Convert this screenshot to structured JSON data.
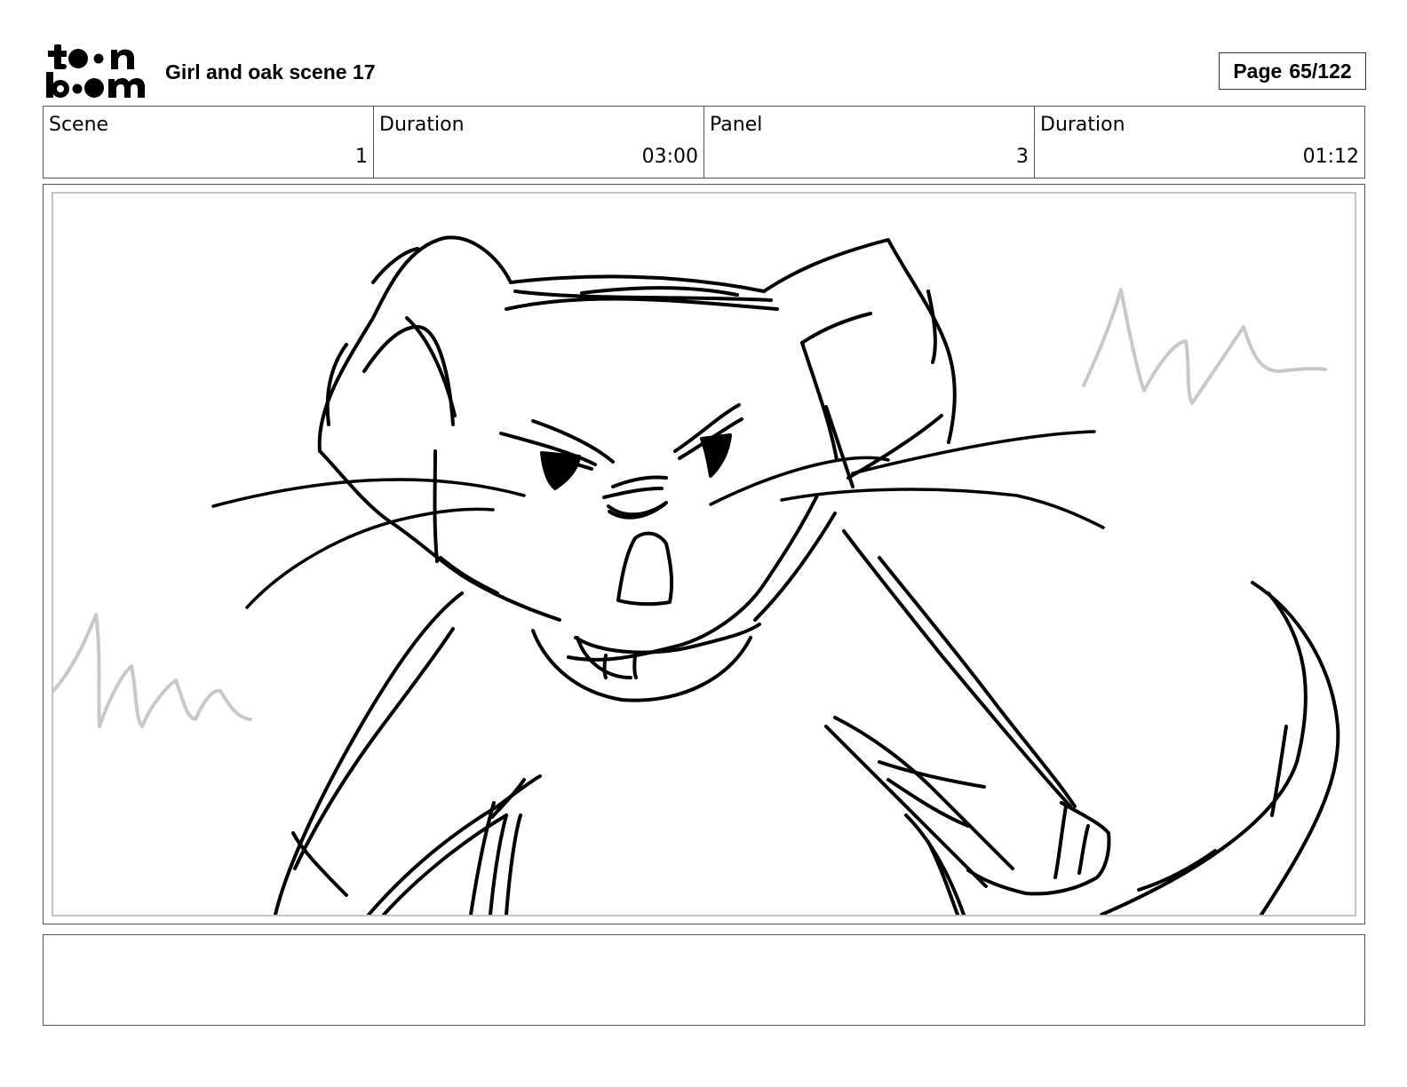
{
  "header": {
    "logo_text": "toon boom",
    "title": "Girl and oak scene 17",
    "page_label": "Page",
    "page_value": "65/122"
  },
  "info": [
    {
      "label": "Scene",
      "value": "1"
    },
    {
      "label": "Duration",
      "value": "03:00"
    },
    {
      "label": "Panel",
      "value": "3"
    },
    {
      "label": "Duration",
      "value": "01:12"
    }
  ],
  "panel": {
    "drawing": "rough sketch of an angry mouse leaning forward"
  },
  "notes": {
    "text": ""
  }
}
